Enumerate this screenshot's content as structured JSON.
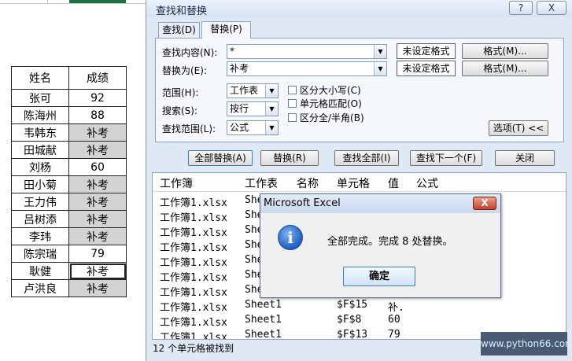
{
  "sheet": {
    "header": [
      "姓名",
      "成绩"
    ],
    "rows": [
      {
        "name": "张可",
        "score": "92"
      },
      {
        "name": "陈海州",
        "score": "88"
      },
      {
        "name": "韦韩东",
        "score": "补考"
      },
      {
        "name": "田城献",
        "score": "补考"
      },
      {
        "name": "刘杨",
        "score": "60"
      },
      {
        "name": "田小菊",
        "score": "补考"
      },
      {
        "name": "王力伟",
        "score": "补考"
      },
      {
        "name": "吕树添",
        "score": "补考"
      },
      {
        "name": "李玮",
        "score": "补考"
      },
      {
        "name": "陈宗瑞",
        "score": "79"
      },
      {
        "name": "耿健",
        "score": "补考"
      },
      {
        "name": "卢洪良",
        "score": "补考"
      }
    ]
  },
  "dialog": {
    "title": "查找和替换",
    "help": "?",
    "close": "X",
    "tabs": {
      "find": "查找(D)",
      "replace": "替换(P)"
    },
    "find_label": "查找内容(N):",
    "find_value": "*",
    "replace_label": "替换为(E):",
    "replace_value": "补考",
    "no_format_1": "未设定格式",
    "no_format_2": "未设定格式",
    "format_1": "格式(M)...",
    "format_2": "格式(M)...",
    "scope_label": "范围(H):",
    "scope_value": "工作表",
    "search_label": "搜索(S):",
    "search_value": "按行",
    "lookin_label": "查找范围(L):",
    "lookin_value": "公式",
    "match_case": "区分大小写(C)",
    "match_cell": "单元格匹配(O)",
    "match_width": "区分全/半角(B)",
    "options": "选项(T) <<",
    "buttons": {
      "replace_all": "全部替换(A)",
      "replace": "替换(R)",
      "find_all": "查找全部(I)",
      "find_next": "查找下一个(F)",
      "close": "关闭"
    },
    "results": {
      "headers": [
        "工作簿",
        "工作表",
        "名称",
        "单元格",
        "值",
        "公式"
      ],
      "rows": [
        {
          "book": "工作簿1.xlsx",
          "sheet": "She",
          "cell": "",
          "value": ""
        },
        {
          "book": "工作簿1.xlsx",
          "sheet": "She",
          "cell": "",
          "value": ""
        },
        {
          "book": "工作簿1.xlsx",
          "sheet": "She",
          "cell": "",
          "value": ""
        },
        {
          "book": "工作簿1.xlsx",
          "sheet": "She",
          "cell": "",
          "value": ""
        },
        {
          "book": "工作簿1.xlsx",
          "sheet": "She",
          "cell": "",
          "value": ""
        },
        {
          "book": "工作簿1.xlsx",
          "sheet": "She",
          "cell": "",
          "value": ""
        },
        {
          "book": "工作簿1.xlsx",
          "sheet": "She",
          "cell": "",
          "value": ""
        },
        {
          "book": "工作簿1.xlsx",
          "sheet": "Sheet1",
          "cell": "$F$15",
          "value": "补."
        },
        {
          "book": "工作簿1.xlsx",
          "sheet": "Sheet1",
          "cell": "$F$8",
          "value": "60"
        },
        {
          "book": "工作簿1.xlsx",
          "sheet": "Sheet1",
          "cell": "$F$13",
          "value": "79"
        }
      ]
    },
    "status": "12 个单元格被找到"
  },
  "msgbox": {
    "title": "Microsoft Excel",
    "close": "X",
    "icon": "info-icon",
    "message": "全部完成。完成 8 处替换。",
    "ok": "确定"
  },
  "watermark": "www.python66.com",
  "colors": {
    "highlight_cell": "#d3d3d3",
    "dialog_bg": "#dfe8f5",
    "sheet_selection": "#1e7145"
  }
}
